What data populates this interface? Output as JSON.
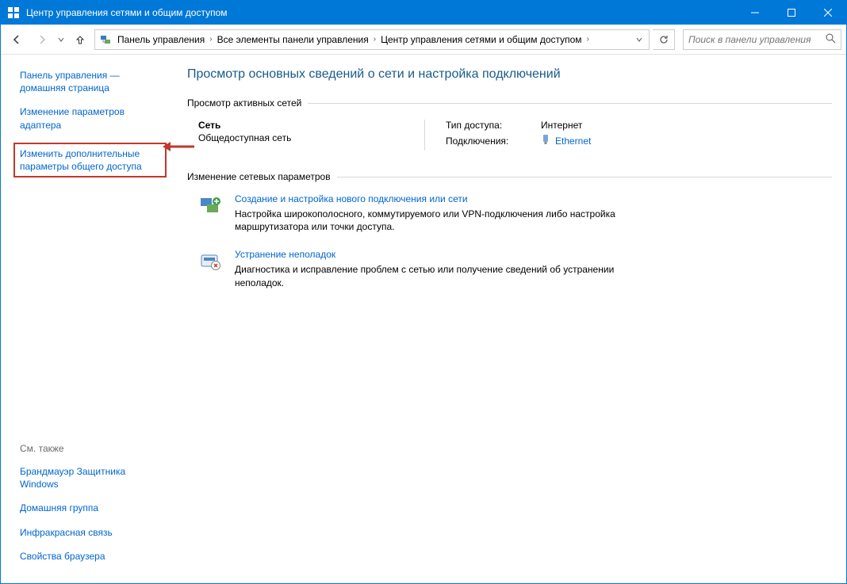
{
  "window": {
    "title": "Центр управления сетями и общим доступом"
  },
  "breadcrumb": {
    "items": [
      "Панель управления",
      "Все элементы панели управления",
      "Центр управления сетями и общим доступом"
    ]
  },
  "search": {
    "placeholder": "Поиск в панели управления"
  },
  "sidebar": {
    "homepage": "Панель управления — домашняя страница",
    "adapter_settings": "Изменение параметров адаптера",
    "advanced_sharing": "Изменить дополнительные параметры общего доступа",
    "see_also_header": "См. также",
    "see_also": {
      "firewall": "Брандмауэр Защитника Windows",
      "homegroup": "Домашняя группа",
      "infrared": "Инфракрасная связь",
      "internet_options": "Свойства браузера"
    }
  },
  "main": {
    "heading": "Просмотр основных сведений о сети и настройка подключений",
    "active_networks_label": "Просмотр активных сетей",
    "network": {
      "name": "Сеть",
      "type": "Общедоступная сеть",
      "access_label": "Тип доступа:",
      "access_value": "Интернет",
      "connections_label": "Подключения:",
      "connection_link": "Ethernet"
    },
    "change_settings_label": "Изменение сетевых параметров",
    "tasks": {
      "new_connection": {
        "title": "Создание и настройка нового подключения или сети",
        "desc": "Настройка широкополосного, коммутируемого или VPN-подключения либо настройка маршрутизатора или точки доступа."
      },
      "troubleshoot": {
        "title": "Устранение неполадок",
        "desc": "Диагностика и исправление проблем с сетью или получение сведений об устранении неполадок."
      }
    }
  }
}
